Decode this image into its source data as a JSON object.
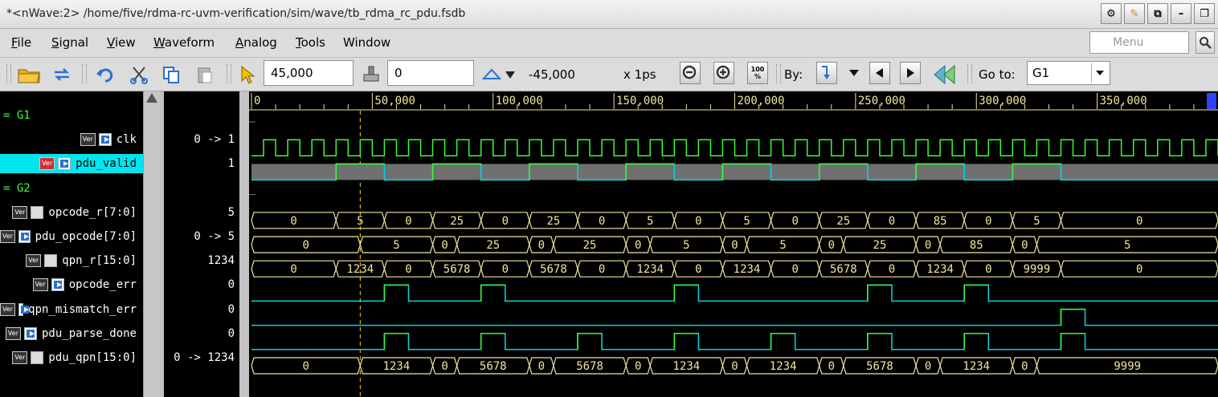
{
  "window": {
    "title": "*<nWave:2> /home/five/rdma-rc-uvm-verification/sim/wave/tb_rdma_rc_pdu.fsdb",
    "buttons": [
      "gear-icon",
      "pin-icon",
      "tile-icon",
      "minimize-icon",
      "maximize-icon"
    ]
  },
  "menu": {
    "items": [
      {
        "label": "File",
        "ul": "F",
        "rest": "ile"
      },
      {
        "label": "Signal",
        "ul": "S",
        "rest": "ignal"
      },
      {
        "label": "View",
        "ul": "V",
        "rest": "iew"
      },
      {
        "label": "Waveform",
        "ul": "W",
        "rest": "aveform"
      },
      {
        "label": "Analog",
        "ul": "A",
        "rest": "nalog"
      },
      {
        "label": "Tools",
        "ul": "T",
        "rest": "ools"
      },
      {
        "label": "Window",
        "ul": "",
        "rest": "Window"
      }
    ],
    "search_placeholder": "Menu"
  },
  "toolbar": {
    "cursor_time": "45,000",
    "marker_time": "0",
    "delta": "-45,000",
    "unit": "x 1ps",
    "zoom_label": "100 %",
    "by_label": "By:",
    "goto_label": "Go to:",
    "goto_value": "G1"
  },
  "ruler": {
    "labels": [
      "0",
      "50,000",
      "100,000",
      "150,000",
      "200,000",
      "250,000",
      "300,000",
      "350,000"
    ],
    "cursor_time": 45000
  },
  "timeline": {
    "start": 0,
    "end": 400000,
    "clk_period": 10000
  },
  "signals": [
    {
      "kind": "blank",
      "name": ""
    },
    {
      "kind": "group",
      "name": "= G1"
    },
    {
      "kind": "clock",
      "name": "clk",
      "value": "0 -> 1"
    },
    {
      "kind": "bit",
      "name": "pdu_valid",
      "value": "1",
      "selected": true,
      "highs": [
        [
          35000,
          55000
        ],
        [
          75000,
          95000
        ],
        [
          115000,
          135000
        ],
        [
          155000,
          175000
        ],
        [
          195000,
          215000
        ],
        [
          235000,
          255000
        ],
        [
          275000,
          295000
        ],
        [
          315000,
          335000
        ]
      ],
      "valid": true
    },
    {
      "kind": "group",
      "name": "= G2"
    },
    {
      "kind": "bus",
      "name": "opcode_r[7:0]",
      "value": "5",
      "segs": [
        [
          0,
          35000,
          "0"
        ],
        [
          35000,
          55000,
          "5"
        ],
        [
          55000,
          75000,
          "0"
        ],
        [
          75000,
          95000,
          "25"
        ],
        [
          95000,
          115000,
          "0"
        ],
        [
          115000,
          135000,
          "25"
        ],
        [
          135000,
          155000,
          "0"
        ],
        [
          155000,
          175000,
          "5"
        ],
        [
          175000,
          195000,
          "0"
        ],
        [
          195000,
          215000,
          "5"
        ],
        [
          215000,
          235000,
          "0"
        ],
        [
          235000,
          255000,
          "25"
        ],
        [
          255000,
          275000,
          "0"
        ],
        [
          275000,
          295000,
          "85"
        ],
        [
          295000,
          315000,
          "0"
        ],
        [
          315000,
          335000,
          "5"
        ],
        [
          335000,
          400000,
          "0"
        ]
      ]
    },
    {
      "kind": "bus",
      "name": "pdu_opcode[7:0]",
      "value": "0 -> 5",
      "segs": [
        [
          0,
          45000,
          "0"
        ],
        [
          45000,
          75000,
          "5"
        ],
        [
          75000,
          85000,
          "0"
        ],
        [
          85000,
          115000,
          "25"
        ],
        [
          115000,
          125000,
          "0"
        ],
        [
          125000,
          155000,
          "25"
        ],
        [
          155000,
          165000,
          "0"
        ],
        [
          165000,
          195000,
          "5"
        ],
        [
          195000,
          205000,
          "0"
        ],
        [
          205000,
          235000,
          "5"
        ],
        [
          235000,
          245000,
          "0"
        ],
        [
          245000,
          275000,
          "25"
        ],
        [
          275000,
          285000,
          "0"
        ],
        [
          285000,
          315000,
          "85"
        ],
        [
          315000,
          325000,
          "0"
        ],
        [
          325000,
          400000,
          "5"
        ]
      ]
    },
    {
      "kind": "bus",
      "name": "qpn_r[15:0]",
      "value": "1234",
      "segs": [
        [
          0,
          35000,
          "0"
        ],
        [
          35000,
          55000,
          "1234"
        ],
        [
          55000,
          75000,
          "0"
        ],
        [
          75000,
          95000,
          "5678"
        ],
        [
          95000,
          115000,
          "0"
        ],
        [
          115000,
          135000,
          "5678"
        ],
        [
          135000,
          155000,
          "0"
        ],
        [
          155000,
          175000,
          "1234"
        ],
        [
          175000,
          195000,
          "0"
        ],
        [
          195000,
          215000,
          "1234"
        ],
        [
          215000,
          235000,
          "0"
        ],
        [
          235000,
          255000,
          "5678"
        ],
        [
          255000,
          275000,
          "0"
        ],
        [
          275000,
          295000,
          "1234"
        ],
        [
          295000,
          315000,
          "0"
        ],
        [
          315000,
          335000,
          "9999"
        ],
        [
          335000,
          400000,
          "0"
        ]
      ]
    },
    {
      "kind": "bit",
      "name": "opcode_err",
      "value": "0",
      "highs": [
        [
          55000,
          65000
        ],
        [
          95000,
          105000
        ],
        [
          175000,
          185000
        ],
        [
          255000,
          265000
        ],
        [
          295000,
          305000
        ]
      ]
    },
    {
      "kind": "bit",
      "name": "qpn_mismatch_err",
      "value": "0",
      "highs": [
        [
          335000,
          345000
        ]
      ]
    },
    {
      "kind": "bit",
      "name": "pdu_parse_done",
      "value": "0",
      "highs": [
        [
          55000,
          65000
        ],
        [
          95000,
          105000
        ],
        [
          135000,
          145000
        ],
        [
          175000,
          185000
        ],
        [
          215000,
          225000
        ],
        [
          255000,
          265000
        ],
        [
          295000,
          305000
        ],
        [
          335000,
          345000
        ]
      ]
    },
    {
      "kind": "bus",
      "name": "pdu_qpn[15:0]",
      "value": "0 -> 1234",
      "segs": [
        [
          0,
          45000,
          "0"
        ],
        [
          45000,
          75000,
          "1234"
        ],
        [
          75000,
          85000,
          "0"
        ],
        [
          85000,
          115000,
          "5678"
        ],
        [
          115000,
          125000,
          "0"
        ],
        [
          125000,
          155000,
          "5678"
        ],
        [
          155000,
          165000,
          "0"
        ],
        [
          165000,
          195000,
          "1234"
        ],
        [
          195000,
          205000,
          "0"
        ],
        [
          205000,
          235000,
          "1234"
        ],
        [
          235000,
          245000,
          "0"
        ],
        [
          245000,
          275000,
          "5678"
        ],
        [
          275000,
          285000,
          "0"
        ],
        [
          285000,
          315000,
          "1234"
        ],
        [
          315000,
          325000,
          "0"
        ],
        [
          325000,
          400000,
          "9999"
        ]
      ]
    }
  ],
  "colors": {
    "wave_green": "#33ff33",
    "wave_cyan": "#00d8e0",
    "bus_yellow": "#f2e6a0",
    "valid_gray": "#707070",
    "cursor": "#ffd700",
    "selection": "#00e5ee"
  }
}
